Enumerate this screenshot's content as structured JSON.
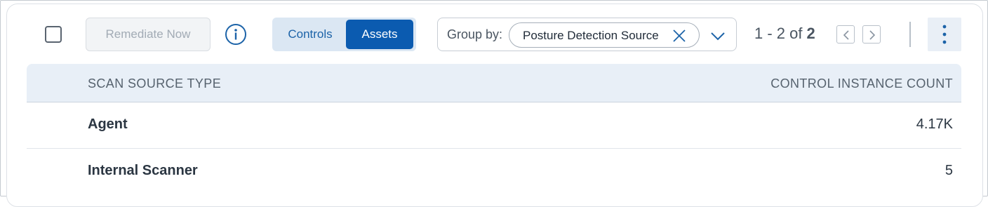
{
  "toolbar": {
    "select_all_checked": false,
    "remediate_label": "Remediate Now",
    "remediate_enabled": false,
    "info_icon": "info-icon",
    "view_toggle": {
      "options": [
        "Controls",
        "Assets"
      ],
      "selected": "Assets"
    },
    "group_by": {
      "label": "Group by:",
      "selected_value": "Posture Detection Source"
    },
    "pagination": {
      "range": "1 - 2 of",
      "total": "2"
    },
    "more_icon": "kebab-icon"
  },
  "table": {
    "columns": [
      "SCAN SOURCE TYPE",
      "CONTROL INSTANCE COUNT"
    ],
    "rows": [
      {
        "name": "Agent",
        "count": "4.17K"
      },
      {
        "name": "Internal Scanner",
        "count": "5"
      }
    ]
  },
  "colors": {
    "primary": "#0b5bb0",
    "toggle_bg": "#dbe7f3",
    "header_bg": "#e8eff7"
  }
}
